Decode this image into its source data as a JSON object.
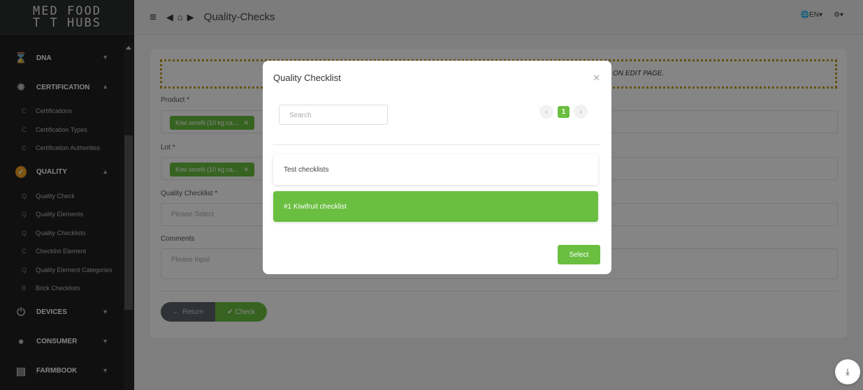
{
  "app": {
    "logo_line1": "MED FOOD",
    "logo_line2": "T   T HUBS"
  },
  "sidebar": {
    "groups": [
      {
        "label": "DNA",
        "icon": "hourglass-icon"
      },
      {
        "label": "CERTIFICATION",
        "icon": "badge-icon"
      },
      {
        "label": "QUALITY",
        "icon": "check-circle-icon"
      },
      {
        "label": "DEVICES",
        "icon": "power-icon"
      },
      {
        "label": "CONSUMER",
        "icon": "user-icon"
      },
      {
        "label": "FARMBOOK",
        "icon": "book-icon"
      }
    ],
    "cert_items": [
      {
        "prefix": "C",
        "label": "Certifications"
      },
      {
        "prefix": "C",
        "label": "Certification Types"
      },
      {
        "prefix": "C",
        "label": "Certification Authorities"
      }
    ],
    "quality_items": [
      {
        "prefix": "Q",
        "label": "Quality Check"
      },
      {
        "prefix": "Q",
        "label": "Quality Elements"
      },
      {
        "prefix": "Q",
        "label": "Quality Checklists"
      },
      {
        "prefix": "C",
        "label": "Checklist Element"
      },
      {
        "prefix": "Q",
        "label": "Quality Element Categories"
      },
      {
        "prefix": "B",
        "label": "Brick Checklists"
      }
    ]
  },
  "header": {
    "title": "Quality-Checks",
    "lang": "EN"
  },
  "form": {
    "notice": "ON EDIT PAGE.",
    "product_label": "Product *",
    "product_tag": "Kiwi sorelli (10 kg ca...",
    "lot_label": "Lot *",
    "lot_tag": "Kiwi sorelli (10 kg ca...",
    "checklist_label": "Quality Checklist *",
    "checklist_placeholder": "Please Select",
    "comments_label": "Comments",
    "comments_placeholder": "Please Input",
    "return_label": "Return",
    "check_label": "Check"
  },
  "modal": {
    "title": "Quality Checklist",
    "search_placeholder": "Search",
    "current_page": "1",
    "options": [
      "Test checklists",
      "#1 Kiwifruit checklist"
    ],
    "selected_option": "#1 Kiwifruit checklist",
    "select_label": "Select"
  },
  "colors": {
    "accent": "#6abf40",
    "sidebar_bg": "#1f2020",
    "notice_border": "#c49a1a"
  }
}
